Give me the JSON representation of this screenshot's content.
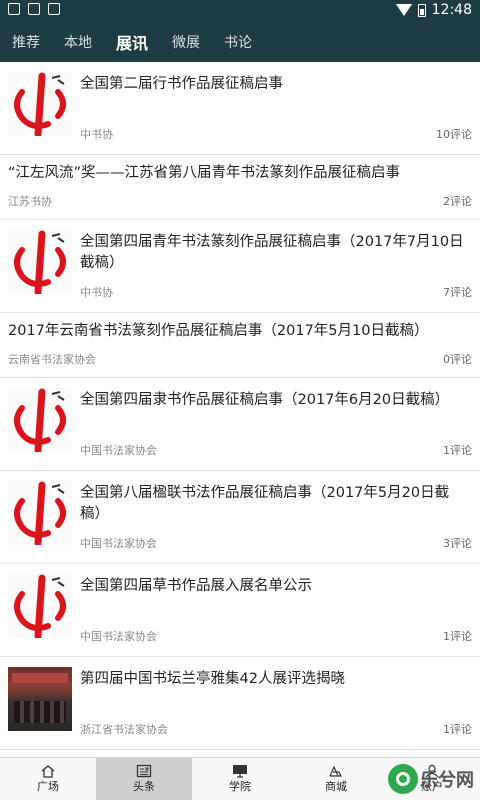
{
  "status_bar": {
    "time": "12:48"
  },
  "tabs": [
    {
      "label": "推荐"
    },
    {
      "label": "本地"
    },
    {
      "label": "展讯"
    },
    {
      "label": "微展"
    },
    {
      "label": "书论"
    }
  ],
  "active_tab_index": 2,
  "news": [
    {
      "title": "全国第二届行书作品展征稿启事",
      "source": "中书协",
      "comments": "10评论",
      "thumb": "logo"
    },
    {
      "title": "“江左风流”奖——江苏省第八届青年书法篆刻作品展征稿启事",
      "source": "江苏书协",
      "comments": "2评论",
      "thumb": "none"
    },
    {
      "title": "全国第四届青年书法篆刻作品展征稿启事（2017年7月10日截稿）",
      "source": "中书协",
      "comments": "7评论",
      "thumb": "logo"
    },
    {
      "title": "2017年云南省书法篆刻作品展征稿启事（2017年5月10日截稿）",
      "source": "云南省书法家协会",
      "comments": "0评论",
      "thumb": "none"
    },
    {
      "title": "全国第四届隶书作品展征稿启事（2017年6月20日截稿）",
      "source": "中国书法家协会",
      "comments": "1评论",
      "thumb": "logo"
    },
    {
      "title": "全国第八届楹联书法作品展征稿启事（2017年5月20日截稿）",
      "source": "中国书法家协会",
      "comments": "3评论",
      "thumb": "logo"
    },
    {
      "title": "全国第四届草书作品展入展名单公示",
      "source": "中国书法家协会",
      "comments": "1评论",
      "thumb": "logo"
    },
    {
      "title": "第四届中国书坛兰亭雅集42人展评选揭晓",
      "source": "浙江省书法家协会",
      "comments": "1评论",
      "thumb": "photo"
    }
  ],
  "bottom_nav": [
    {
      "label": "广场",
      "icon": "home-icon"
    },
    {
      "label": "头条",
      "icon": "newspaper-icon"
    },
    {
      "label": "学院",
      "icon": "monitor-icon"
    },
    {
      "label": "商城",
      "icon": "shop-icon"
    },
    {
      "label": "账户",
      "icon": "user-icon"
    }
  ],
  "active_nav_index": 1,
  "watermark": {
    "text": "乐兮网"
  },
  "colors": {
    "header_bg": "#1e3c44",
    "logo_red": "#d9141b"
  }
}
